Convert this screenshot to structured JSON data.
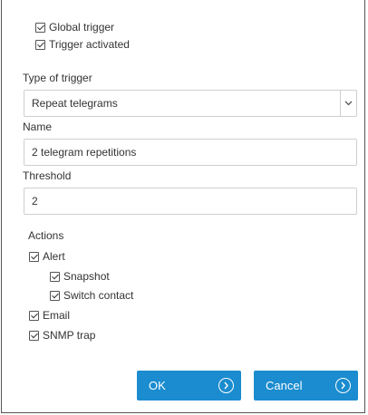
{
  "checkboxes_top": {
    "global_trigger": {
      "label": "Global trigger",
      "checked": true
    },
    "trigger_activated": {
      "label": "Trigger activated",
      "checked": true
    }
  },
  "type_of_trigger": {
    "label": "Type of trigger",
    "value": "Repeat telegrams"
  },
  "name": {
    "label": "Name",
    "value": "2 telegram repetitions"
  },
  "threshold": {
    "label": "Threshold",
    "value": "2"
  },
  "actions": {
    "label": "Actions",
    "alert": {
      "label": "Alert",
      "checked": true
    },
    "snapshot": {
      "label": "Snapshot",
      "checked": true
    },
    "switch_contact": {
      "label": "Switch contact",
      "checked": true
    },
    "email": {
      "label": "Email",
      "checked": true
    },
    "snmp_trap": {
      "label": "SNMP trap",
      "checked": true
    }
  },
  "buttons": {
    "ok": "OK",
    "cancel": "Cancel"
  },
  "colors": {
    "button_bg": "#1a8ccf",
    "border": "#cfcfcf"
  }
}
